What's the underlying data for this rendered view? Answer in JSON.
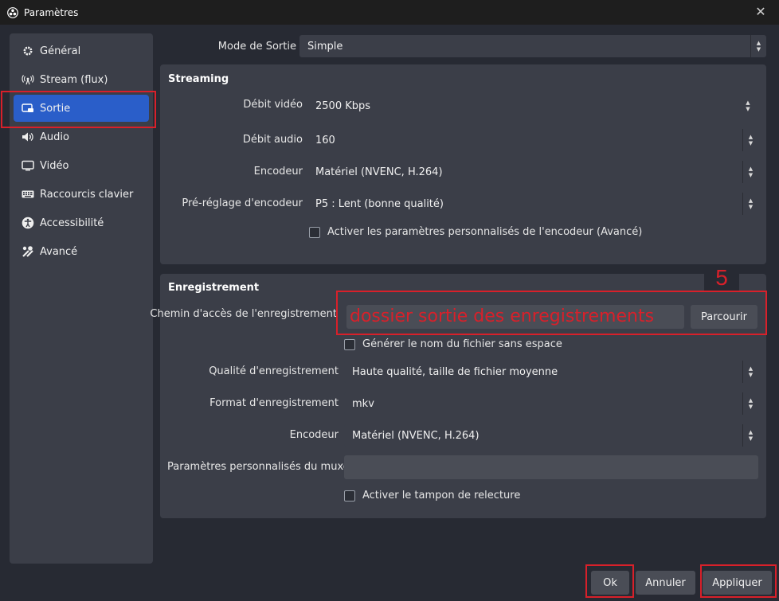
{
  "window": {
    "title": "Paramètres"
  },
  "sidebar": {
    "items": [
      {
        "label": "Général",
        "icon": "gear-icon"
      },
      {
        "label": "Stream (flux)",
        "icon": "antenna-icon"
      },
      {
        "label": "Sortie",
        "icon": "output-icon",
        "active": true
      },
      {
        "label": "Audio",
        "icon": "speaker-icon"
      },
      {
        "label": "Vidéo",
        "icon": "monitor-icon"
      },
      {
        "label": "Raccourcis clavier",
        "icon": "keyboard-icon"
      },
      {
        "label": "Accessibilité",
        "icon": "accessibility-icon"
      },
      {
        "label": "Avancé",
        "icon": "tools-icon"
      }
    ]
  },
  "output_mode": {
    "label": "Mode de Sortie",
    "value": "Simple"
  },
  "streaming": {
    "title": "Streaming",
    "video_bitrate": {
      "label": "Débit vidéo",
      "value": "2500 Kbps"
    },
    "audio_bitrate": {
      "label": "Débit audio",
      "value": "160"
    },
    "encoder": {
      "label": "Encodeur",
      "value": "Matériel (NVENC, H.264)"
    },
    "encoder_preset": {
      "label": "Pré-réglage d'encodeur",
      "value": "P5 : Lent (bonne qualité)"
    },
    "custom_encoder_checkbox": {
      "label": "Activer les paramètres personnalisés de l'encodeur (Avancé)",
      "checked": false
    }
  },
  "recording": {
    "title": "Enregistrement",
    "path": {
      "label": "Chemin d'accès de l'enregistrement",
      "value": "dossier sortie des enregistrements"
    },
    "browse_label": "Parcourir",
    "no_space_checkbox": {
      "label": "Générer le nom du fichier sans espace",
      "checked": false
    },
    "quality": {
      "label": "Qualité d'enregistrement",
      "value": "Haute qualité, taille de fichier moyenne"
    },
    "format": {
      "label": "Format d'enregistrement",
      "value": "mkv"
    },
    "encoder": {
      "label": "Encodeur",
      "value": "Matériel (NVENC, H.264)"
    },
    "muxer": {
      "label": "Paramètres personnalisés du muxer",
      "value": ""
    },
    "replay_checkbox": {
      "label": "Activer le tampon de relecture",
      "checked": false
    }
  },
  "annotation": {
    "step_number": "5",
    "highlight_color": "#d8202a"
  },
  "footer": {
    "ok": "Ok",
    "cancel": "Annuler",
    "apply": "Appliquer"
  },
  "colors": {
    "accent": "#2a5ec9",
    "panel": "#3b3e48",
    "background": "#272a33"
  }
}
